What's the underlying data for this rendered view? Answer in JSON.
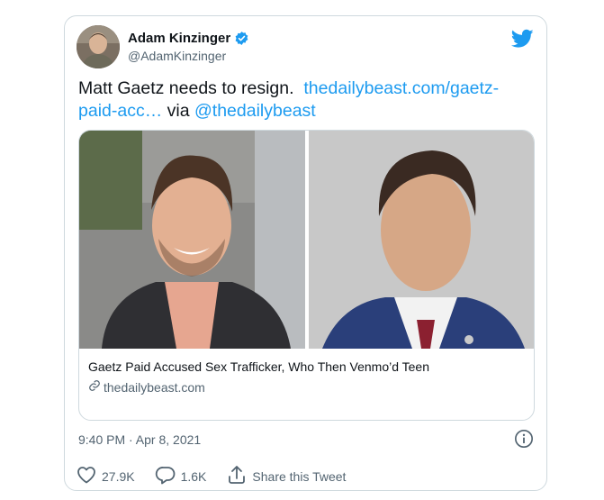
{
  "author": {
    "name": "Adam Kinzinger",
    "handle": "@AdamKinzinger",
    "verified": true
  },
  "tweet": {
    "text_prefix": "Matt Gaetz needs to resign.",
    "link_text": "thedailybeast.com/gaetz-paid-acc…",
    "via_text": "via",
    "mention": "@thedailybeast"
  },
  "link_card": {
    "title": "Gaetz Paid Accused Sex Trafficker, Who Then Venmo’d Teen",
    "domain": "thedailybeast.com"
  },
  "timestamp": "9:40 PM · Apr 8, 2021",
  "actions": {
    "like_count": "27.9K",
    "reply_count": "1.6K",
    "share_label": "Share this Tweet"
  },
  "colors": {
    "accent": "#1d9bf0",
    "text": "#0f1419",
    "muted": "#536471",
    "border": "#cfd9de"
  },
  "icons": [
    "verified-badge-icon",
    "twitter-bird-icon",
    "link-icon",
    "info-icon",
    "heart-icon",
    "reply-icon",
    "share-icon"
  ]
}
